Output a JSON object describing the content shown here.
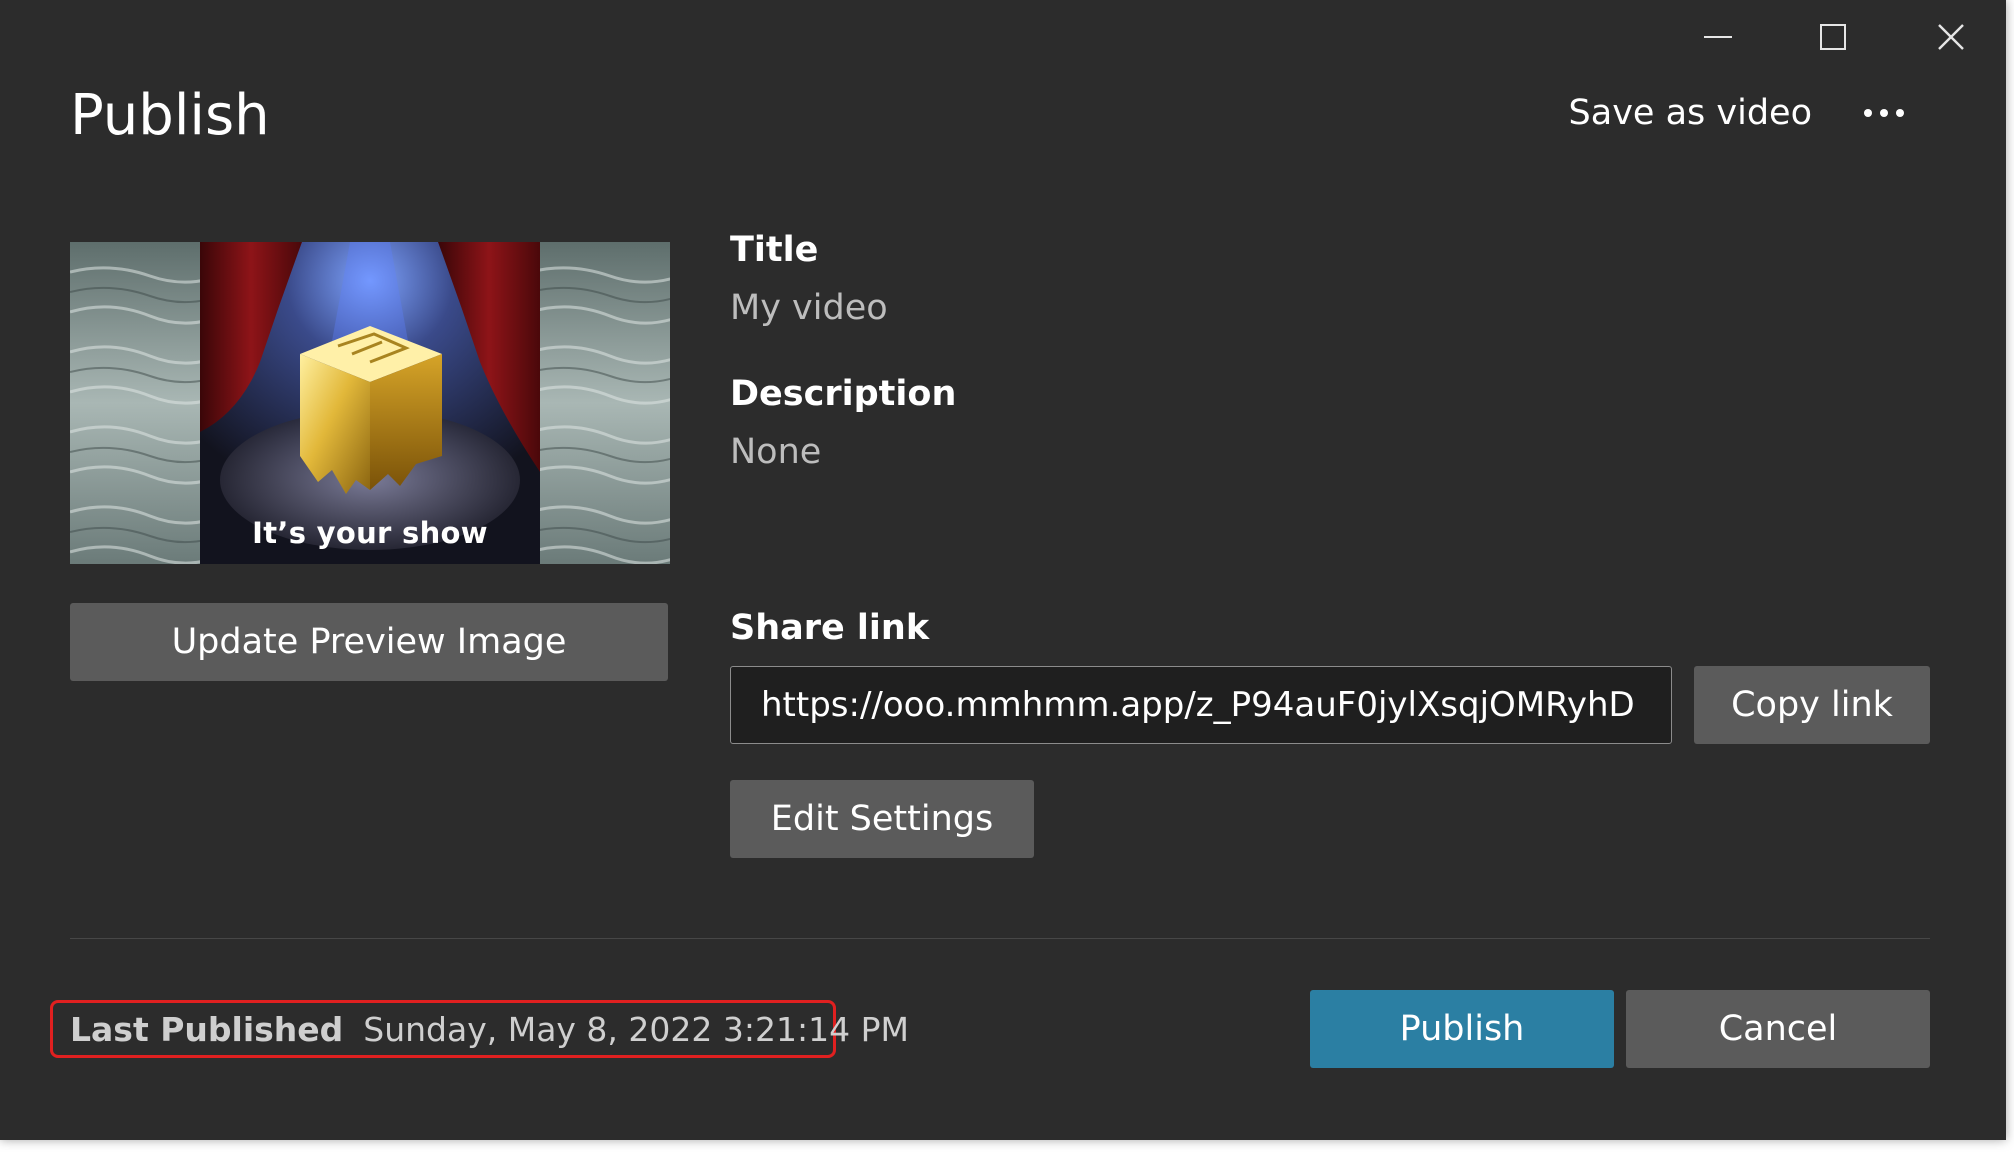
{
  "window": {
    "title": "Publish"
  },
  "header": {
    "save_as_video": "Save as video"
  },
  "preview": {
    "caption": "It’s your show",
    "update_button": "Update Preview Image"
  },
  "fields": {
    "title_label": "Title",
    "title_value": "My video",
    "description_label": "Description",
    "description_value": "None",
    "share_link_label": "Share link",
    "share_link_value": "https://ooo.mmhmm.app/z_P94auF0jylXsqjOMRyhD",
    "copy_link_button": "Copy link",
    "edit_settings_button": "Edit Settings"
  },
  "footer": {
    "last_published_label": "Last Published",
    "last_published_value": "Sunday, May 8, 2022 3:21:14 PM",
    "publish_button": "Publish",
    "cancel_button": "Cancel"
  },
  "colors": {
    "background": "#2c2c2c",
    "button": "#5b5b5b",
    "primary": "#2b7fa3",
    "highlight": "#e02020"
  },
  "icons": {
    "minimize": "minimize-icon",
    "maximize": "maximize-icon",
    "close": "close-icon",
    "more": "more-options-icon"
  }
}
